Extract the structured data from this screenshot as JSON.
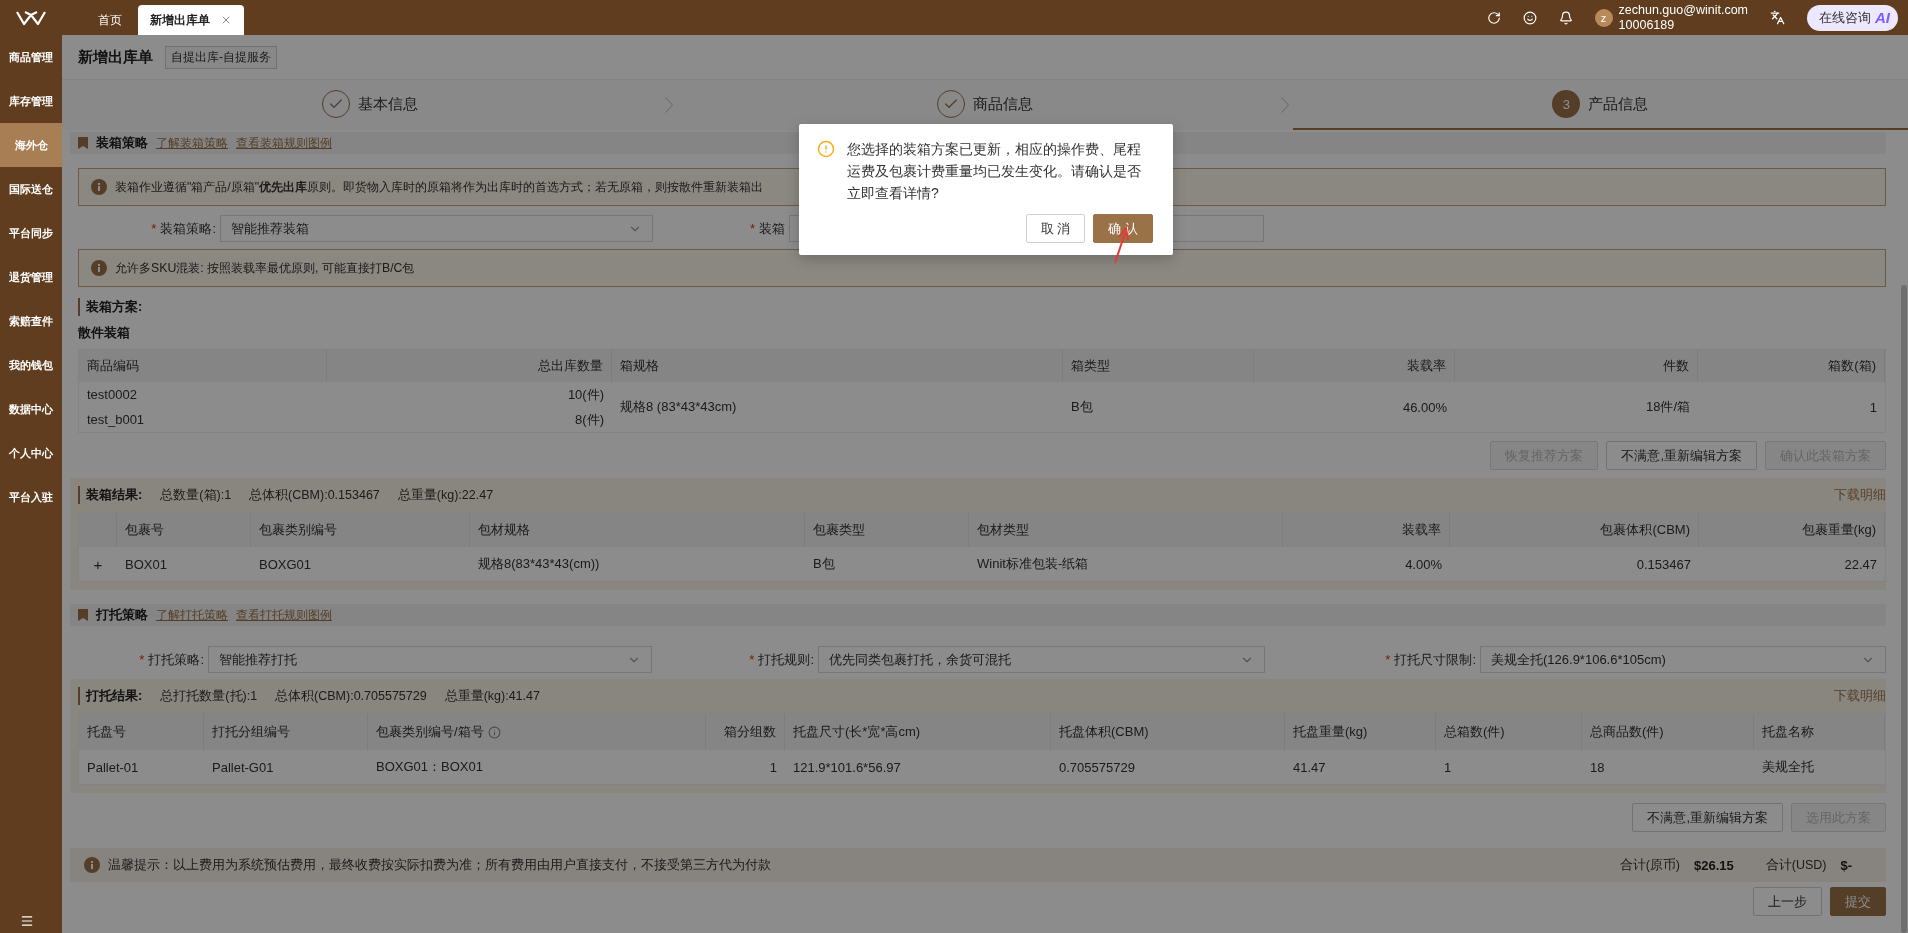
{
  "top_bar": {
    "tabs": [
      {
        "label": "首页",
        "selected": false,
        "closable": false
      },
      {
        "label": "新增出库单",
        "selected": true,
        "closable": true
      }
    ],
    "user": {
      "avatar": "z",
      "email": "zechun.guo@winit.com",
      "id": "10006189"
    },
    "consult_button": {
      "label": "在线咨询",
      "badge": "AI"
    }
  },
  "sidebar": {
    "items": [
      {
        "label": "商品管理",
        "selected": false
      },
      {
        "label": "库存管理",
        "selected": false
      },
      {
        "label": "海外仓",
        "selected": true
      },
      {
        "label": "国际送仓",
        "selected": false
      },
      {
        "label": "平台同步",
        "selected": false
      },
      {
        "label": "退货管理",
        "selected": false
      },
      {
        "label": "索赔查件",
        "selected": false
      },
      {
        "label": "我的钱包",
        "selected": false
      },
      {
        "label": "数据中心",
        "selected": false
      },
      {
        "label": "个人中心",
        "selected": false
      },
      {
        "label": "平台入驻",
        "selected": false
      }
    ]
  },
  "page_header": {
    "title": "新增出库单",
    "tag": "自提出库-自提服务"
  },
  "steps": [
    {
      "label": "基本信息",
      "kind": "done"
    },
    {
      "label": "商品信息",
      "kind": "done"
    },
    {
      "number": "3",
      "label": "产品信息",
      "kind": "active"
    }
  ],
  "packing_strategy": {
    "title": "装箱策略",
    "links": [
      "了解装箱策略",
      "查看装箱规则图例"
    ],
    "notice": "装箱作业遵循\"箱产品/原箱\"**优先出库**原则。即货物入库时的原箱将作为出库时的首选方式；若无原箱，则按散件重新装箱出",
    "fields": [
      {
        "required_mark": "*",
        "label": "装箱策略:",
        "value": "智能推荐装箱"
      },
      {
        "required_mark": "*",
        "label": "装箱"
      }
    ],
    "mix_notice": "允许多SKU混装: 按照装载率最优原则, 可能直接打B/C包"
  },
  "packing_plan": {
    "title": "装箱方案:",
    "subtitle": "散件装箱",
    "columns": [
      "商品编码",
      "总出库数量",
      "箱规格",
      "箱类型",
      "装载率",
      "件数",
      "箱数(箱)"
    ],
    "items": [
      {
        "code": "test0002",
        "qty": "10(件)"
      },
      {
        "code": "test_b001",
        "qty": "8(件)"
      }
    ],
    "shared": [
      "规格8 (83*43*43cm)",
      "B包",
      "46.00%",
      "18件/箱",
      "1"
    ],
    "buttons": [
      {
        "label": "恢复推荐方案",
        "disabled": true
      },
      {
        "label": "不满意,重新编辑方案",
        "disabled": false
      },
      {
        "label": "确认此装箱方案",
        "disabled": true
      }
    ]
  },
  "packing_result": {
    "title": "装箱结果:",
    "stats": [
      "总数量(箱):1",
      "总体积(CBM):0.153467",
      "总重量(kg):22.47"
    ],
    "download": "下载明细",
    "columns": [
      "包裹号",
      "包裹类别编号",
      "包材规格",
      "包裹类型",
      "包材类型",
      "装载率",
      "包裹体积(CBM)",
      "包裹重量(kg)"
    ],
    "rows": [
      {
        "expand": "+",
        "cells": [
          "BOX01",
          "BOXG01",
          "规格8(83*43*43(cm))",
          "B包",
          "Winit标准包装-纸箱",
          "4.00%",
          "0.153467",
          "22.47"
        ]
      }
    ]
  },
  "pallet_strategy": {
    "title": "打托策略",
    "links": [
      "了解打托策略",
      "查看打托规则图例"
    ],
    "fields": [
      {
        "required_mark": "*",
        "label": "打托策略:",
        "value": "智能推荐打托"
      },
      {
        "required_mark": "*",
        "label": "打托规则:",
        "value": "优先同类包裹打托，余货可混托"
      },
      {
        "required_mark": "*",
        "label": "打托尺寸限制:",
        "value": "美规全托(126.9*106.6*105cm)"
      }
    ]
  },
  "pallet_result": {
    "title": "打托结果:",
    "stats": [
      "总打托数量(托):1",
      "总体积(CBM):0.705575729",
      "总重量(kg):41.47"
    ],
    "download": "下载明细",
    "columns": [
      {
        "label": "托盘号",
        "info": false
      },
      {
        "label": "打托分组编号",
        "info": false
      },
      {
        "label": "包裹类别编号/箱号",
        "info": true
      },
      {
        "label": "箱分组数",
        "info": false
      },
      {
        "label": "托盘尺寸(长*宽*高cm)",
        "info": false
      },
      {
        "label": "托盘体积(CBM)",
        "info": false
      },
      {
        "label": "托盘重量(kg)",
        "info": false
      },
      {
        "label": "总箱数(件)",
        "info": false
      },
      {
        "label": "总商品数(件)",
        "info": false
      },
      {
        "label": "托盘名称",
        "info": false
      }
    ],
    "rows": [
      [
        "Pallet-01",
        "Pallet-G01",
        "BOXG01：BOX01",
        "1",
        "121.9*101.6*56.97",
        "0.705575729",
        "41.47",
        "1",
        "18",
        "美规全托"
      ]
    ],
    "buttons": [
      {
        "label": "不满意,重新编辑方案",
        "disabled": false
      },
      {
        "label": "选用此方案",
        "disabled": true
      }
    ]
  },
  "tip": {
    "text": "温馨提示：以上费用为系统预估费用，最终收费按实际扣费为准；所有费用由用户直接支付，不接受第三方代为付款",
    "totals": [
      {
        "label": "合计(原币)",
        "value": "$26.15"
      },
      {
        "label": "合计(USD)",
        "value": "$-"
      }
    ]
  },
  "footer_buttons": [
    {
      "label": "上一步",
      "kind": "default"
    },
    {
      "label": "提交",
      "kind": "primary"
    }
  ],
  "dialog": {
    "message": "您选择的装箱方案已更新，相应的操作费、尾程运费及包裹计费重量均已发生变化。请确认是否立即查看详情?",
    "buttons": [
      {
        "label": "取 消",
        "kind": "default"
      },
      {
        "label": "确 认",
        "kind": "primary"
      }
    ]
  }
}
